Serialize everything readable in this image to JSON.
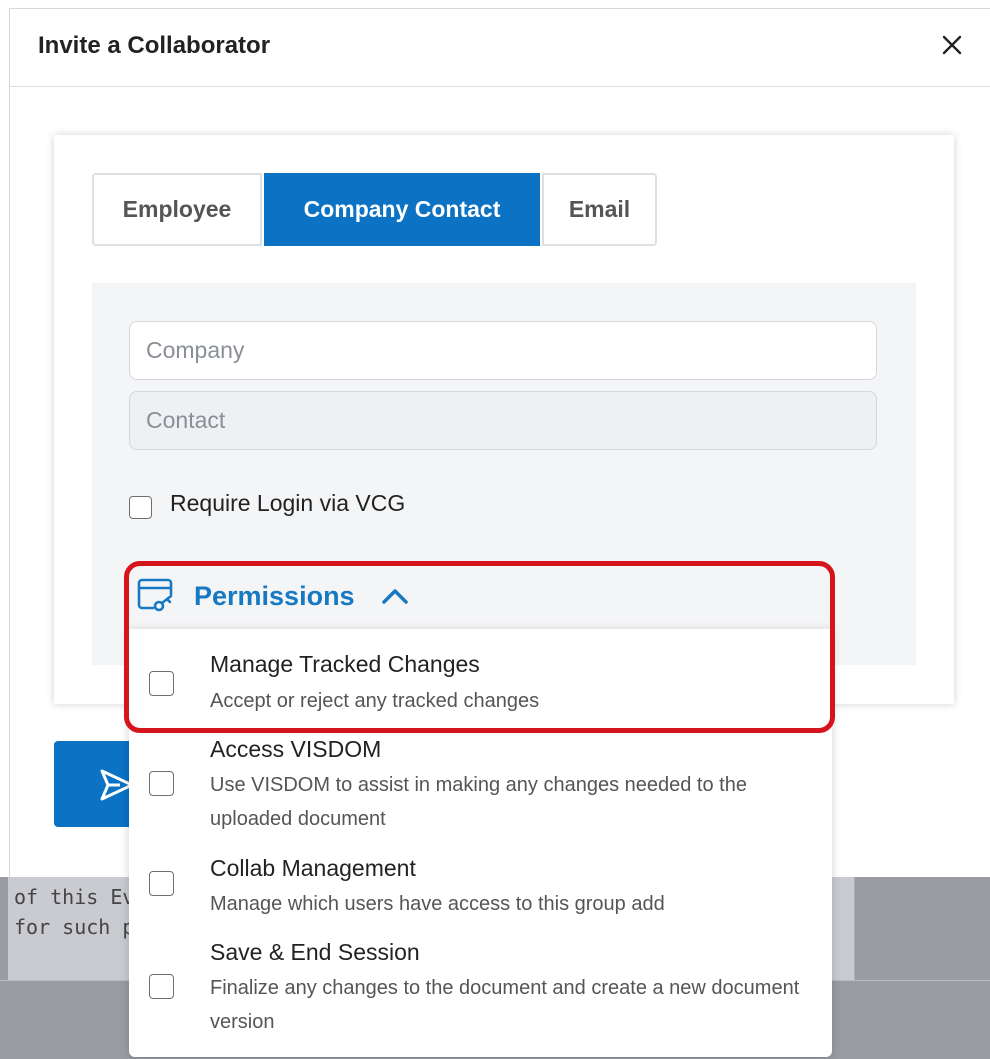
{
  "modal": {
    "title": "Invite a Collaborator"
  },
  "tabs": [
    {
      "label": "Employee",
      "active": false
    },
    {
      "label": "Company Contact",
      "active": true
    },
    {
      "label": "Email",
      "active": false
    }
  ],
  "form": {
    "company_placeholder": "Company",
    "contact_placeholder": "Contact",
    "require_login_label": "Require Login via VCG"
  },
  "permissions": {
    "header_label": "Permissions",
    "items": [
      {
        "title": "Manage Tracked Changes",
        "description": "Accept or reject any tracked changes"
      },
      {
        "title": "Access VISDOM",
        "description": "Use VISDOM to assist in making any changes needed to the uploaded document"
      },
      {
        "title": "Collab Management",
        "description": "Manage which users have access to this group add"
      },
      {
        "title": "Save & End Session",
        "description": "Finalize any changes to the document and create a new document version"
      }
    ]
  },
  "background": {
    "line1": "of this Ev",
    "line2": "for such p"
  },
  "colors": {
    "accent": "#0b72c4",
    "permissions_text": "#1779c2",
    "highlight": "#d6141c"
  },
  "icons": {
    "close": "close-icon",
    "permissions": "permissions-key-icon",
    "chevron": "chevron-up-icon",
    "send": "send-icon"
  }
}
